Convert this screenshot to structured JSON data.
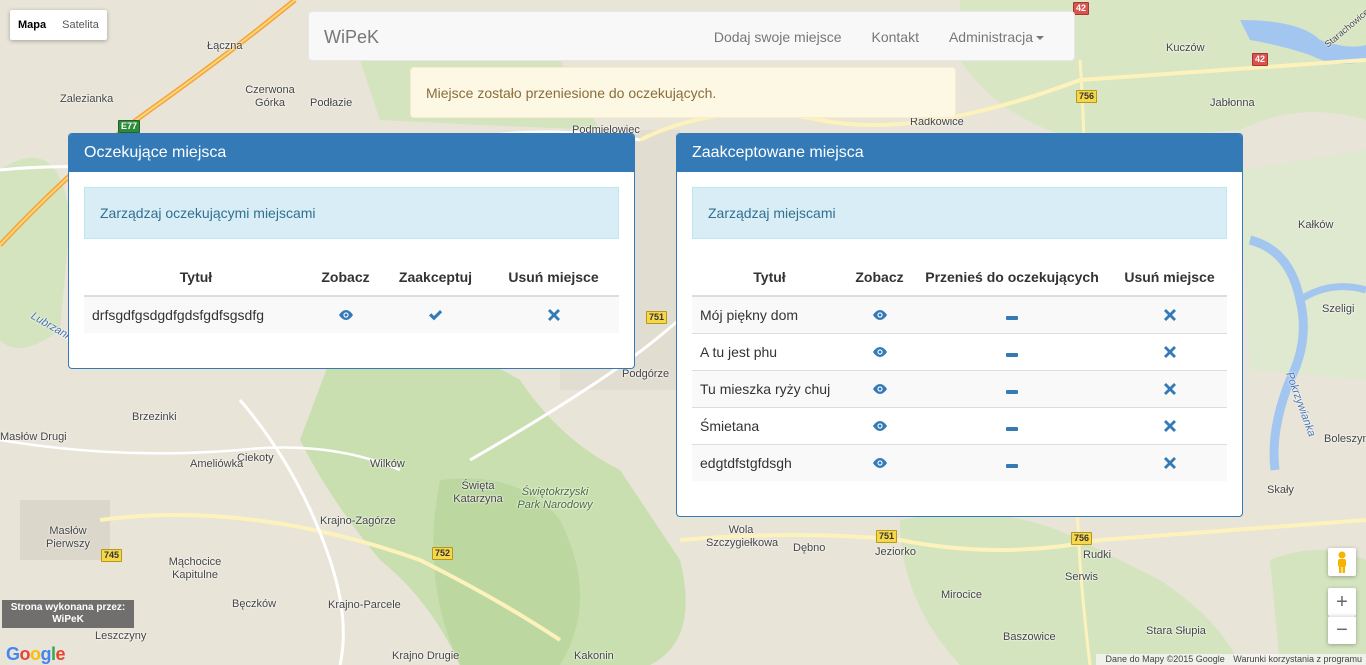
{
  "map": {
    "type_control": {
      "map_label": "Mapa",
      "satellite_label": "Satelita"
    },
    "labels": [
      "Łączna",
      "Zalezianka",
      "Czerwona Górka",
      "Podłazie",
      "Podmielowiec",
      "Radkowice",
      "Kuczów",
      "Jabłonna",
      "Kałków",
      "Szeligi",
      "Brzezinki",
      "Masłów Drugi",
      "Ciekoty",
      "Wilków",
      "Ameliówka",
      "Święta Katarzyna",
      "Świętokrzyski Park Narodowy",
      "Krajno-Zagórze",
      "Masłów Pierwszy",
      "Mąchocice Kapitulne",
      "Bęczków",
      "Krajno-Parcele",
      "Leszczyny",
      "Krajno Drugie",
      "Kakonin",
      "Wola Szczygiełkowa",
      "Dębno",
      "Jeziorko",
      "Rudki",
      "Serwis",
      "Mirocice",
      "Baszowice",
      "Stara Słupia",
      "Skały",
      "Boleszyn",
      "Podgórze",
      "Lubrzanka",
      "Pokrzywianka",
      "Starachowice"
    ],
    "road_numbers": [
      "E77",
      "42",
      "42",
      "756",
      "751",
      "751",
      "752",
      "745",
      "756"
    ],
    "credit": {
      "line1": "Strona wykonana przez:",
      "line2": "WiPeK"
    },
    "google": "Google",
    "footer": {
      "data": "Dane do Mapy ©2015 Google",
      "terms": "Warunki korzystania z programu"
    },
    "zoom_in": "+",
    "zoom_out": "−"
  },
  "navbar": {
    "brand": "WiPeK",
    "links": [
      "Dodaj swoje miejsce",
      "Kontakt",
      "Administracja"
    ]
  },
  "alert": {
    "message": "Miejsce zostało przeniesione do oczekujących."
  },
  "pending_panel": {
    "title": "Oczekujące miejsca",
    "info": "Zarządzaj oczekującymi miejscami",
    "headers": [
      "Tytuł",
      "Zobacz",
      "Zaakceptuj",
      "Usuń miejsce"
    ],
    "rows": [
      {
        "title": "drfsgdfgsdgdfgdsfgdfsgsdfg",
        "view": "eye-icon",
        "accept": "check-icon",
        "remove": "remove-icon"
      }
    ]
  },
  "accepted_panel": {
    "title": "Zaakceptowane miejsca",
    "info": "Zarządzaj miejscami",
    "headers": [
      "Tytuł",
      "Zobacz",
      "Przenieś do oczekujących",
      "Usuń miejsce"
    ],
    "rows": [
      {
        "title": "Mój piękny dom",
        "view": "eye-icon",
        "move": "minus-icon",
        "remove": "remove-icon"
      },
      {
        "title": "A tu jest phu",
        "view": "eye-icon",
        "move": "minus-icon",
        "remove": "remove-icon"
      },
      {
        "title": "Tu mieszka ryży chuj",
        "view": "eye-icon",
        "move": "minus-icon",
        "remove": "remove-icon"
      },
      {
        "title": "Śmietana",
        "view": "eye-icon",
        "move": "minus-icon",
        "remove": "remove-icon"
      },
      {
        "title": "edgtdfstgfdsgh",
        "view": "eye-icon",
        "move": "minus-icon",
        "remove": "remove-icon"
      }
    ]
  },
  "colors": {
    "primary": "#337ab7",
    "info_bg": "#d9edf7",
    "warning_bg": "#fcf8e3",
    "warning_text": "#8a6d3b"
  }
}
